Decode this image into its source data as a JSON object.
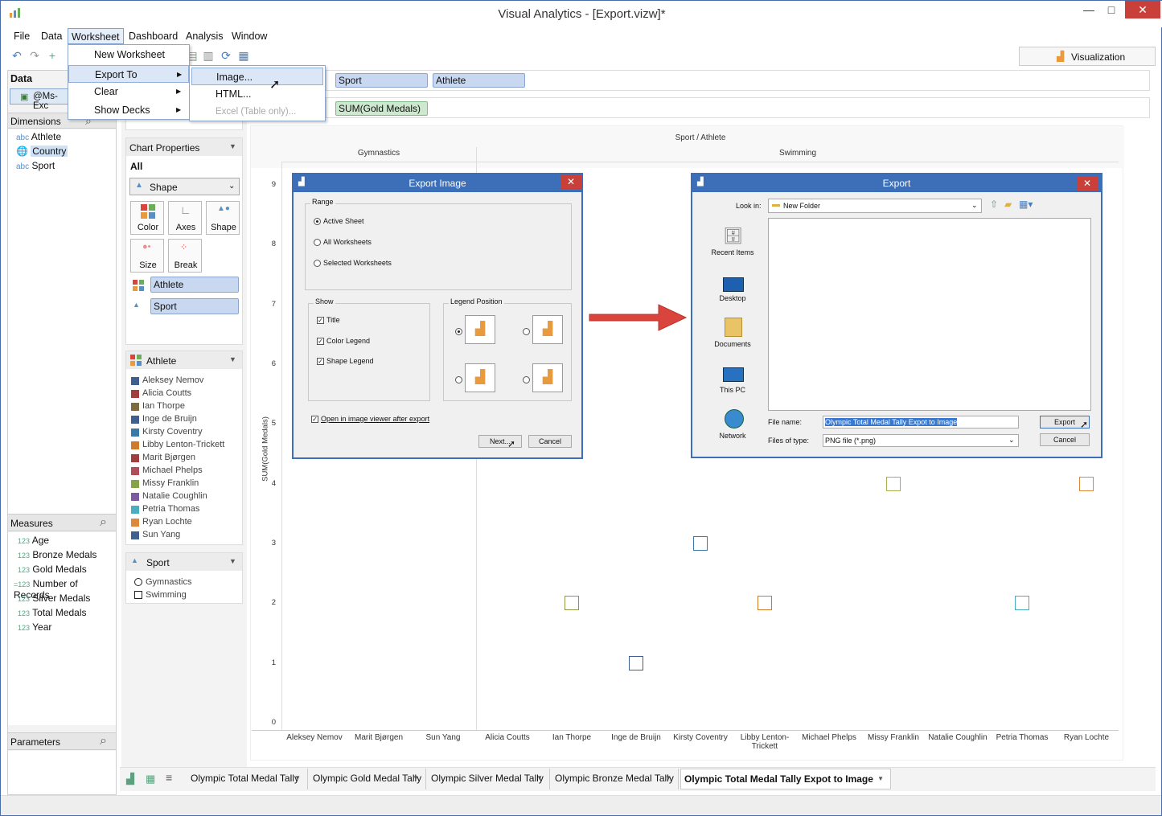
{
  "window": {
    "title": "Visual Analytics - [Export.vizw]*"
  },
  "menu": [
    "File",
    "Data",
    "Worksheet",
    "Dashboard",
    "Analysis",
    "Window"
  ],
  "worksheet_menu": {
    "items": [
      "New Worksheet",
      "Export To",
      "Clear",
      "Show Decks"
    ]
  },
  "export_submenu": {
    "items": [
      "Image...",
      "HTML...",
      "Excel (Table only)..."
    ]
  },
  "visualization_tab": "Visualization",
  "data_panel": {
    "title": "Data",
    "source": "@Ms-Exc",
    "dimensions_title": "Dimensions",
    "dimensions": [
      {
        "type": "abc",
        "name": "Athlete"
      },
      {
        "type": "globe",
        "name": "Country"
      },
      {
        "type": "abc",
        "name": "Sport"
      }
    ],
    "measures_title": "Measures",
    "measures": [
      {
        "type": "123",
        "name": "Age"
      },
      {
        "type": "123",
        "name": "Bronze Medals"
      },
      {
        "type": "123",
        "name": "Gold Medals"
      },
      {
        "type": "=123",
        "name": "Number of Records"
      },
      {
        "type": "123",
        "name": "Silver Medals"
      },
      {
        "type": "123",
        "name": "Total Medals"
      },
      {
        "type": "123",
        "name": "Year"
      }
    ],
    "parameters_title": "Parameters"
  },
  "shelves": {
    "columns": [
      "Sport",
      "Athlete"
    ],
    "rows": [
      "SUM(Gold Medals)"
    ]
  },
  "chart_properties": {
    "title": "Chart Properties",
    "all_label": "All",
    "mark_type": "Shape",
    "buttons": [
      "Color",
      "Axes",
      "Shape",
      "Size",
      "Break"
    ],
    "color_field": "Athlete",
    "shape_field": "Sport"
  },
  "athlete_legend": {
    "title": "Athlete",
    "items": [
      {
        "name": "Aleksey Nemov",
        "color": "#3f5f8f"
      },
      {
        "name": "Alicia Coutts",
        "color": "#a23d3d"
      },
      {
        "name": "Ian Thorpe",
        "color": "#7d6a3e"
      },
      {
        "name": "Inge de Bruijn",
        "color": "#3f5f8f"
      },
      {
        "name": "Kirsty Coventry",
        "color": "#3a7aa8"
      },
      {
        "name": "Libby Lenton-Trickett",
        "color": "#d07a2c"
      },
      {
        "name": "Marit Bjørgen",
        "color": "#a23d3d"
      },
      {
        "name": "Michael Phelps",
        "color": "#b04f57"
      },
      {
        "name": "Missy Franklin",
        "color": "#87a34a"
      },
      {
        "name": "Natalie Coughlin",
        "color": "#7b5aa0"
      },
      {
        "name": "Petria Thomas",
        "color": "#4aaec0"
      },
      {
        "name": "Ryan Lochte",
        "color": "#e0883a"
      },
      {
        "name": "Sun Yang",
        "color": "#3f5f8f"
      }
    ]
  },
  "sport_legend": {
    "title": "Sport",
    "items": [
      "Gymnastics",
      "Swimming"
    ]
  },
  "chart_data": {
    "type": "scatter",
    "title": "Sport / Athlete",
    "panes": [
      "Gymnastics",
      "Swimming"
    ],
    "ylabel": "SUM(Gold Medals)",
    "ylim": [
      0,
      9
    ],
    "yticks": [
      0,
      1,
      2,
      3,
      4,
      5,
      6,
      7,
      8,
      9
    ],
    "categories": [
      "Aleksey Nemov",
      "Marit Bjørgen",
      "Sun Yang",
      "Alicia Coutts",
      "Ian Thorpe",
      "Inge de Bruijn",
      "Kirsty Coventry",
      "Libby Lenton-Trickett",
      "Michael Phelps",
      "Missy Franklin",
      "Natalie Coughlin",
      "Petria Thomas",
      "Ryan Lochte"
    ],
    "visible_points": [
      {
        "athlete": "Ian Thorpe",
        "sport": "Swimming",
        "value": 2,
        "color": "#8a9a46"
      },
      {
        "athlete": "Inge de Bruijn",
        "sport": "Swimming",
        "value": 1,
        "color": "#3f5f8f"
      },
      {
        "athlete": "Kirsty Coventry",
        "sport": "Swimming",
        "value": 3,
        "color": "#3a7aa8"
      },
      {
        "athlete": "Libby Lenton-Trickett",
        "sport": "Swimming",
        "value": 2,
        "color": "#d07a2c"
      },
      {
        "athlete": "Missy Franklin",
        "sport": "Swimming",
        "value": 4,
        "color": "#a7b04a"
      },
      {
        "athlete": "Petria Thomas",
        "sport": "Swimming",
        "value": 2,
        "color": "#4aaec0"
      },
      {
        "athlete": "Ryan Lochte",
        "sport": "Swimming",
        "value": 4,
        "color": "#e0883a"
      }
    ]
  },
  "export_image_dialog": {
    "title": "Export Image",
    "range_label": "Range",
    "range_options": [
      "Active Sheet",
      "All Worksheets",
      "Selected Worksheets"
    ],
    "show_label": "Show",
    "show_options": [
      "Title",
      "Color Legend",
      "Shape Legend"
    ],
    "legend_position_label": "Legend Position",
    "open_viewer_label": "Open in image viewer after export",
    "next_label": "Next...",
    "cancel_label": "Cancel"
  },
  "export_dialog": {
    "title": "Export",
    "look_in_label": "Look in:",
    "look_in_value": "New Folder",
    "places": [
      "Recent Items",
      "Desktop",
      "Documents",
      "This PC",
      "Network"
    ],
    "file_name_label": "File name:",
    "file_name_value": "Olympic Total Medal Tally Expot to Image",
    "files_type_label": "Files of type:",
    "files_type_value": "PNG file (*.png)",
    "export_label": "Export",
    "cancel_label": "Cancel"
  },
  "sheet_tabs": [
    "Olympic Total Medal Tally",
    "Olympic Gold Medal Tally",
    "Olympic Silver Medal Tally",
    "Olympic Bronze Medal Tally",
    "Olympic Total Medal Tally Expot to Image"
  ]
}
